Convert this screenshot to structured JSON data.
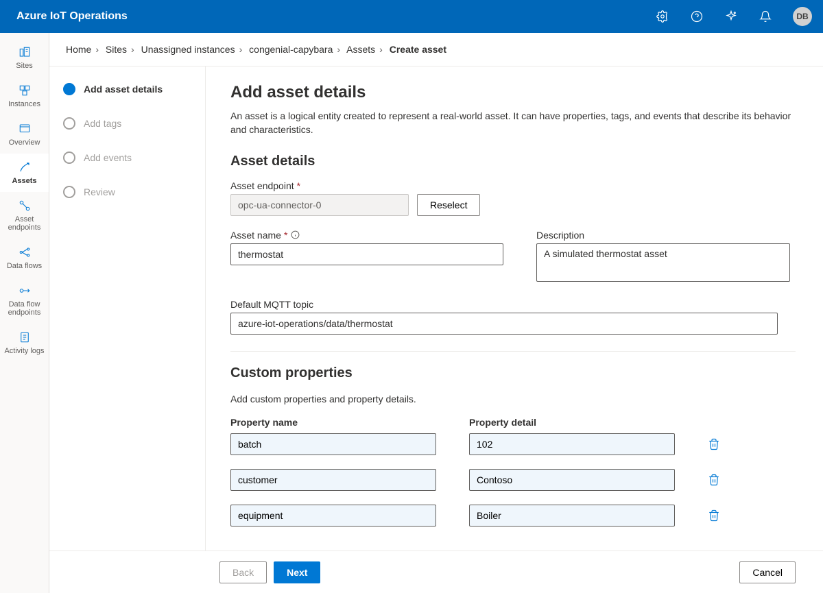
{
  "header": {
    "brand": "Azure IoT Operations",
    "avatar_initials": "DB"
  },
  "sidebar": {
    "items": [
      {
        "id": "sites",
        "label": "Sites"
      },
      {
        "id": "instances",
        "label": "Instances"
      },
      {
        "id": "overview",
        "label": "Overview"
      },
      {
        "id": "assets",
        "label": "Assets"
      },
      {
        "id": "asset-endpoints",
        "label": "Asset endpoints"
      },
      {
        "id": "data-flows",
        "label": "Data flows"
      },
      {
        "id": "data-flow-endpoints",
        "label": "Data flow endpoints"
      },
      {
        "id": "activity-logs",
        "label": "Activity logs"
      }
    ],
    "selected_index": 3
  },
  "breadcrumb": {
    "items": [
      "Home",
      "Sites",
      "Unassigned instances",
      "congenial-capybara",
      "Assets"
    ],
    "current": "Create asset"
  },
  "steps": {
    "items": [
      {
        "label": "Add asset details"
      },
      {
        "label": "Add tags"
      },
      {
        "label": "Add events"
      },
      {
        "label": "Review"
      }
    ],
    "current_index": 0
  },
  "form": {
    "title": "Add asset details",
    "description": "An asset is a logical entity created to represent a real-world asset. It can have properties, tags, and events that describe its behavior and characteristics.",
    "section_details_heading": "Asset details",
    "endpoint_label": "Asset endpoint",
    "endpoint_value": "opc-ua-connector-0",
    "reselect_label": "Reselect",
    "name_label": "Asset name",
    "name_value": "thermostat",
    "desc_label": "Description",
    "desc_value": "A simulated thermostat asset",
    "mqtt_label": "Default MQTT topic",
    "mqtt_value": "azure-iot-operations/data/thermostat",
    "section_props_heading": "Custom properties",
    "props_description": "Add custom properties and property details.",
    "prop_name_header": "Property name",
    "prop_detail_header": "Property detail",
    "properties": [
      {
        "name": "batch",
        "detail": "102"
      },
      {
        "name": "customer",
        "detail": "Contoso"
      },
      {
        "name": "equipment",
        "detail": "Boiler"
      }
    ]
  },
  "footer": {
    "back": "Back",
    "next": "Next",
    "cancel": "Cancel"
  }
}
